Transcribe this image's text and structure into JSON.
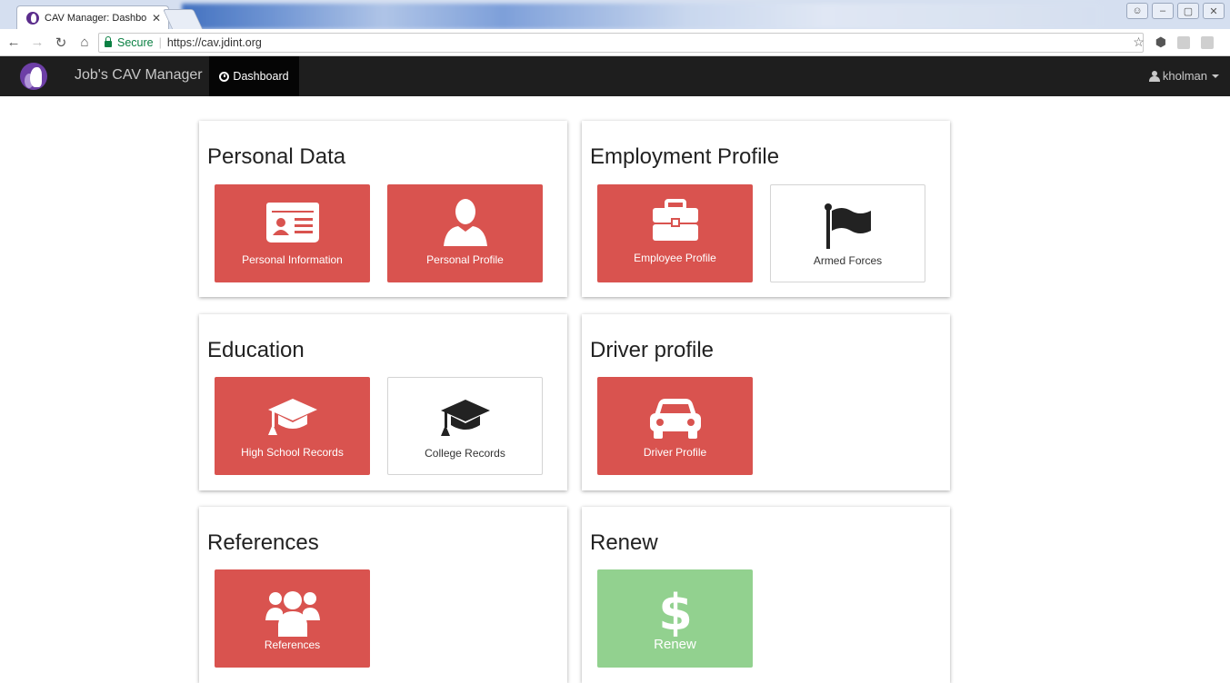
{
  "browser": {
    "tab_title": "CAV Manager: Dashboar",
    "tab_close": "✕",
    "secure_label": "Secure",
    "url": "https://cav.jdint.org"
  },
  "navbar": {
    "brand": "Job's CAV Manager",
    "dashboard_label": "Dashboard",
    "username": "kholman"
  },
  "panels": {
    "personal": {
      "title": "Personal Data",
      "tiles": [
        "Personal Information",
        "Personal Profile"
      ]
    },
    "employment": {
      "title": "Employment Profile",
      "tiles": [
        "Employee Profile",
        "Armed Forces"
      ]
    },
    "education": {
      "title": "Education",
      "tiles": [
        "High School Records",
        "College Records"
      ]
    },
    "driver": {
      "title": "Driver profile",
      "tiles": [
        "Driver Profile"
      ]
    },
    "references": {
      "title": "References",
      "tiles": [
        "References"
      ]
    },
    "renew": {
      "title": "Renew",
      "tiles": [
        "Renew"
      ]
    }
  },
  "colors": {
    "navbar_bg": "#1e1e1e",
    "tile_red": "#d9534f",
    "tile_green": "#92d18f",
    "secure_green": "#0b8043"
  }
}
